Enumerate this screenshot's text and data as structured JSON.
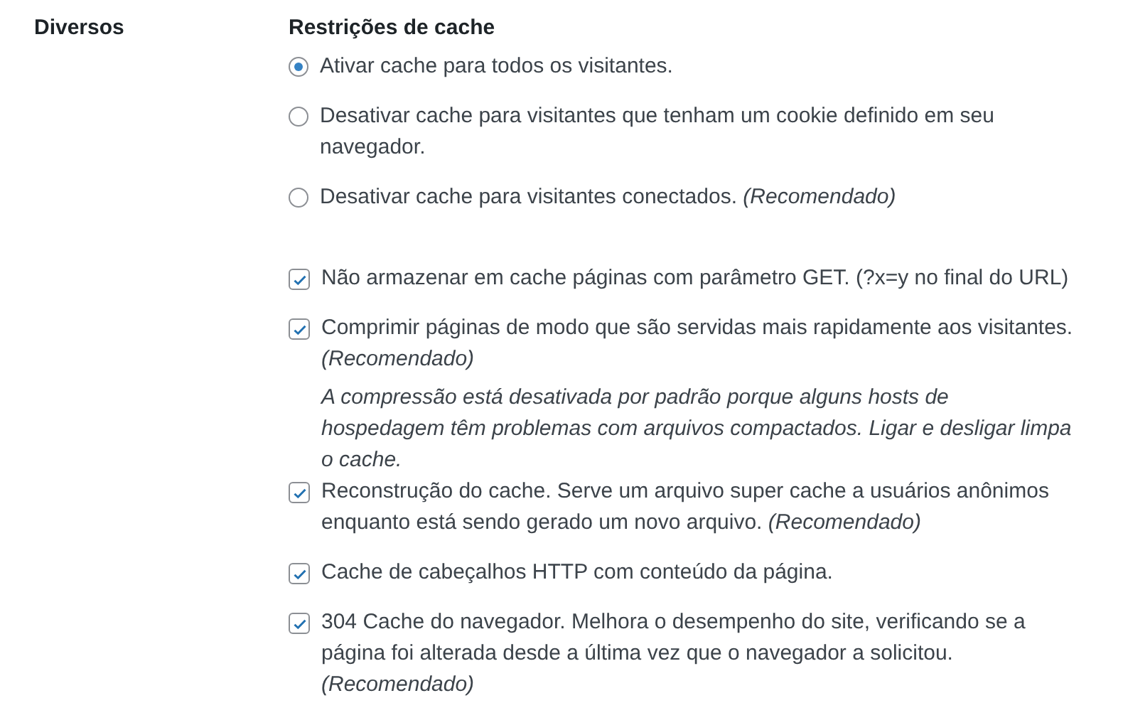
{
  "section": {
    "label": "Diversos"
  },
  "group_title": "Restrições de cache",
  "radios": [
    {
      "label": "Ativar cache para todos os visitantes.",
      "selected": true
    },
    {
      "label": "Desativar cache para visitantes que tenham um cookie definido em seu navegador.",
      "selected": false
    },
    {
      "label": "Desativar cache para visitantes conectados. *(Recomendado)*",
      "selected": false
    }
  ],
  "options": [
    {
      "kind": "checkbox",
      "label": "Não armazenar em cache páginas com parâmetro GET. (?x=y no final do URL)",
      "checked": true
    },
    {
      "kind": "checkbox",
      "label": "Comprimir páginas de modo que são servidas mais rapidamente aos visitantes. *(Recomendado)*",
      "checked": true
    },
    {
      "kind": "note",
      "label": "A compressão está desativada por padrão porque alguns hosts de hospedagem têm problemas com arquivos compactados. Ligar e desligar limpa o cache."
    },
    {
      "kind": "checkbox",
      "label": "Reconstrução do cache. Serve um arquivo super cache a usuários anônimos enquanto está sendo gerado um novo arquivo. *(Recomendado)*",
      "checked": true
    },
    {
      "kind": "checkbox",
      "label": "Cache de cabeçalhos HTTP com conteúdo da página.",
      "checked": true
    },
    {
      "kind": "checkbox",
      "label": "304 Cache do navegador. Melhora o desempenho do site, verificando se a página foi alterada desde a última vez que o navegador a solicitou. *(Recomendado)*",
      "checked": true
    }
  ]
}
